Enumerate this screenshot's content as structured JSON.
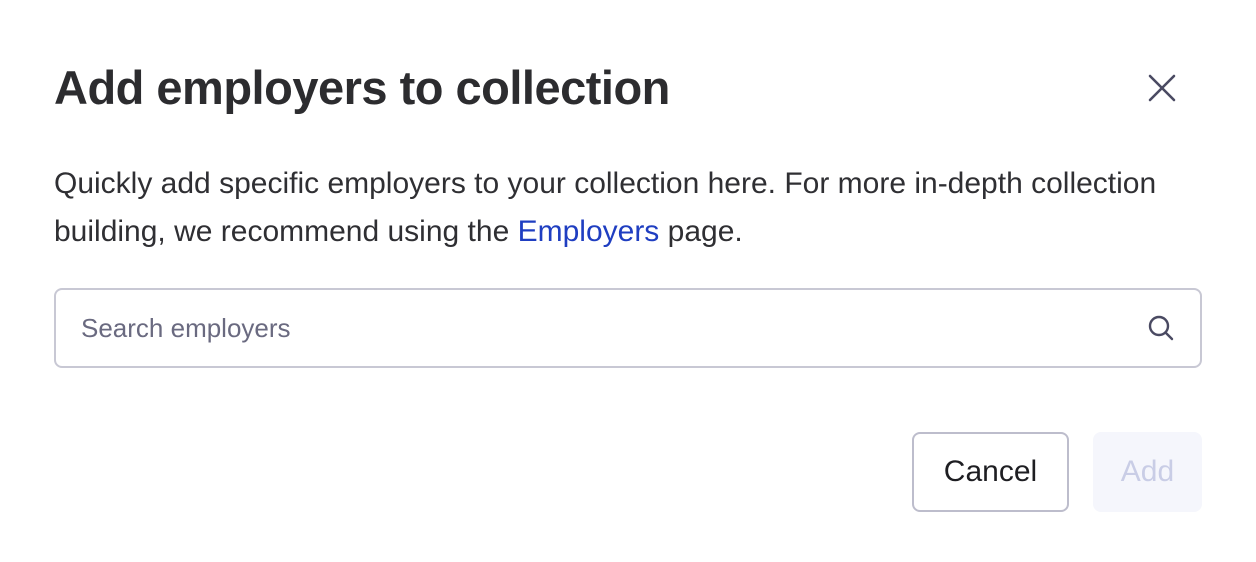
{
  "dialog": {
    "title": "Add employers to collection",
    "description_before": "Quickly add specific employers to your collection here. For more in-depth collection building, we recommend using the ",
    "description_link": "Employers",
    "description_after": " page.",
    "close_icon": "close-icon",
    "search": {
      "placeholder": "Search employers",
      "value": "",
      "icon": "search-icon"
    },
    "buttons": {
      "cancel_label": "Cancel",
      "add_label": "Add",
      "add_disabled": true
    },
    "colors": {
      "title": "#2c2c2f",
      "link": "#1f3ec1",
      "border": "#c8c8d4",
      "add_disabled_bg": "#f5f6fc",
      "add_disabled_text": "#c9cde6"
    }
  }
}
